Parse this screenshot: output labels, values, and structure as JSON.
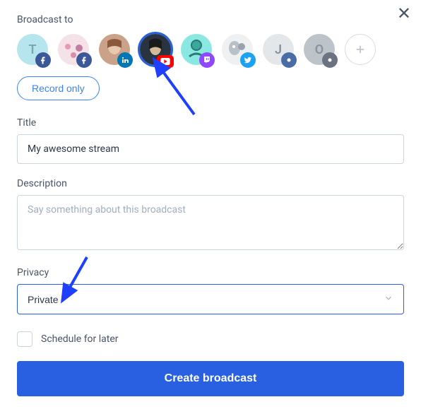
{
  "header": {
    "broadcast_to": "Broadcast to",
    "record_only": "Record only"
  },
  "avatars": [
    {
      "letter": "T",
      "bg": "#b7e5ee",
      "selected": false,
      "badge_name": "facebook-icon",
      "badge_bg": "#3b5998"
    },
    {
      "letter": "",
      "bg": "#f4e2e8",
      "selected": false,
      "badge_name": "facebook-icon",
      "badge_bg": "#3b5998"
    },
    {
      "letter": "",
      "bg": "#caa189",
      "selected": false,
      "badge_name": "linkedin-icon",
      "badge_bg": "#0077b5"
    },
    {
      "letter": "",
      "bg": "#2a3340",
      "selected": true,
      "badge_name": "youtube-icon",
      "badge_bg": "#ff0000"
    },
    {
      "letter": "",
      "bg": "#8ae8e3",
      "selected": false,
      "badge_name": "twitch-icon",
      "badge_bg": "#9146ff"
    },
    {
      "letter": "",
      "bg": "#eef0f2",
      "selected": false,
      "badge_name": "twitter-icon",
      "badge_bg": "#1da1f2"
    },
    {
      "letter": "J",
      "bg": "#e4e7ea",
      "selected": false,
      "badge_name": "platform-icon",
      "badge_bg": "#4a6da7"
    },
    {
      "letter": "O",
      "bg": "#bcc3c9",
      "selected": false,
      "badge_name": "platform-icon",
      "badge_bg": "#6b7280"
    }
  ],
  "add_icon_title": "Add destination",
  "title": {
    "label": "Title",
    "value": "My awesome stream"
  },
  "description": {
    "label": "Description",
    "placeholder": "Say something about this broadcast",
    "value": ""
  },
  "privacy": {
    "label": "Privacy",
    "selected": "Private"
  },
  "schedule": {
    "label": "Schedule for later",
    "checked": false
  },
  "create_button": "Create broadcast",
  "colors": {
    "primary": "#2860e1",
    "arrow": "#1f3fff"
  }
}
